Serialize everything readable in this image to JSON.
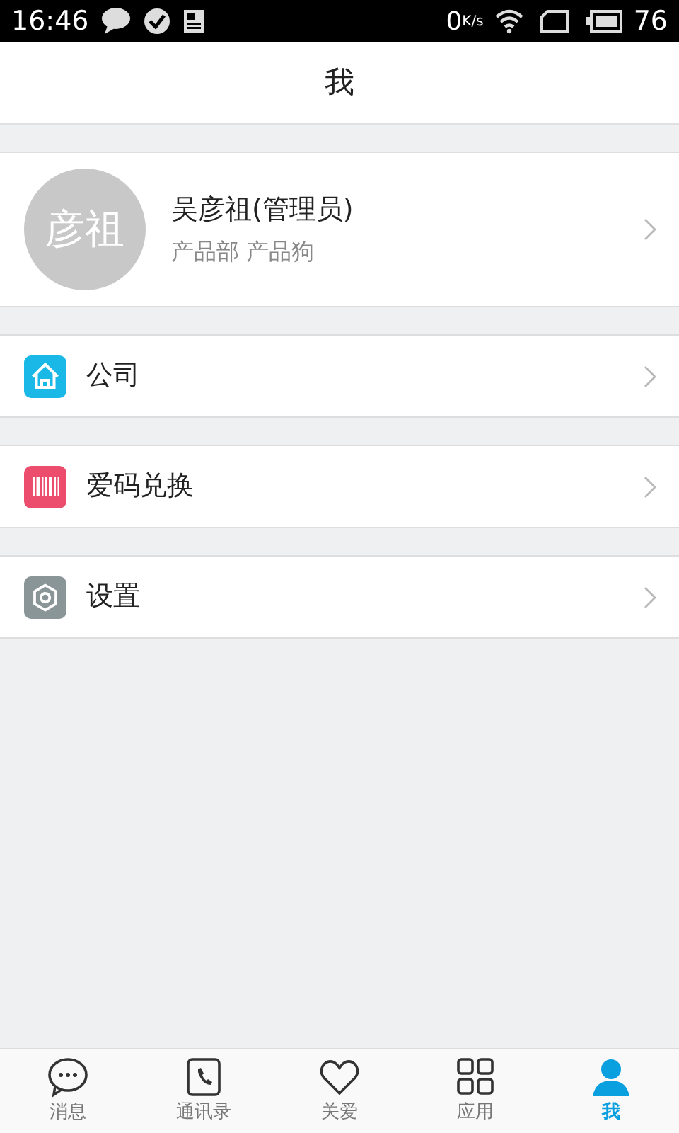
{
  "status_bar": {
    "time": "16:46",
    "speed_value": "0",
    "speed_unit": "K/s",
    "battery": "76"
  },
  "header": {
    "title": "我"
  },
  "profile": {
    "avatar_text": "彦祖",
    "name": "吴彦祖(管理员)",
    "subtitle": "产品部 产品狗"
  },
  "menu_groups": [
    {
      "items": [
        {
          "label": "公司",
          "kind": "home",
          "color": "#1ab8e6"
        }
      ]
    },
    {
      "items": [
        {
          "label": "爱码兑换",
          "kind": "barcode",
          "color": "#ec4d6c"
        }
      ]
    },
    {
      "items": [
        {
          "label": "设置",
          "kind": "gear",
          "color": "#8a9597"
        }
      ]
    }
  ],
  "tabs": [
    {
      "label": "消息",
      "kind": "chat",
      "selected": false
    },
    {
      "label": "通讯录",
      "kind": "contacts",
      "selected": false
    },
    {
      "label": "关爱",
      "kind": "heart",
      "selected": false
    },
    {
      "label": "应用",
      "kind": "apps",
      "selected": false
    },
    {
      "label": "我",
      "kind": "person",
      "selected": true
    }
  ]
}
